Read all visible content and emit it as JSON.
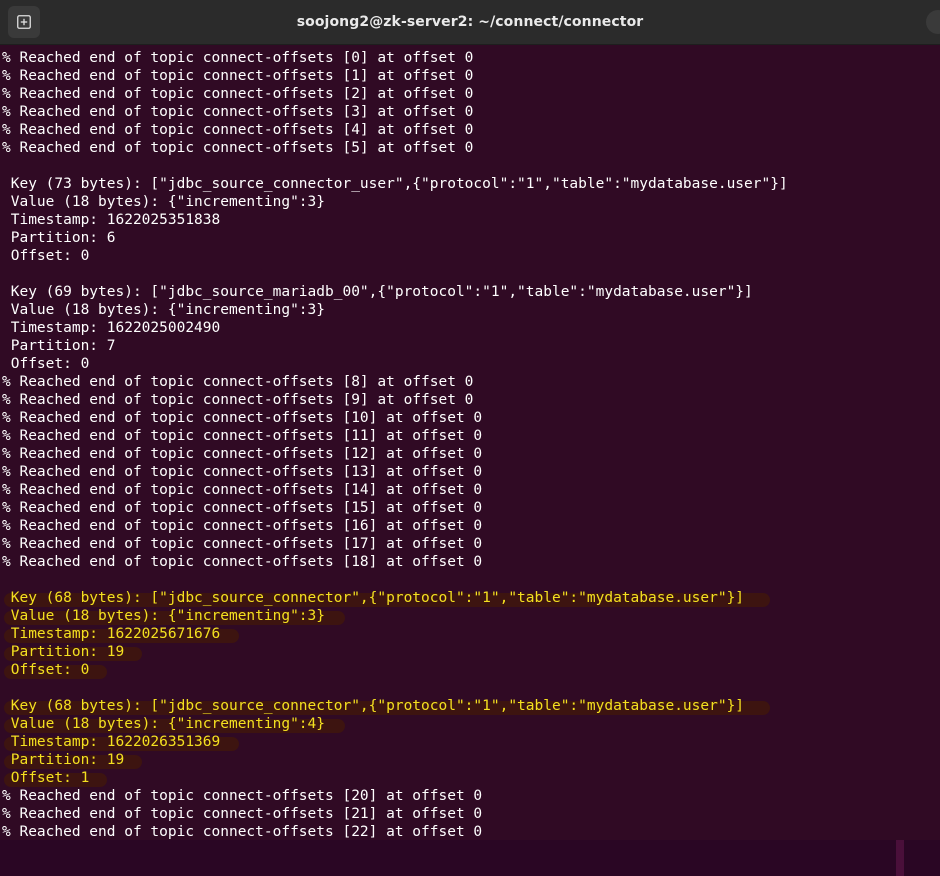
{
  "window": {
    "title": "soojong2@zk-server2: ~/connect/connector"
  },
  "terminal": {
    "lines": [
      {
        "text": "% Reached end of topic connect-offsets [0] at offset 0",
        "highlight": false
      },
      {
        "text": "% Reached end of topic connect-offsets [1] at offset 0",
        "highlight": false
      },
      {
        "text": "% Reached end of topic connect-offsets [2] at offset 0",
        "highlight": false
      },
      {
        "text": "% Reached end of topic connect-offsets [3] at offset 0",
        "highlight": false
      },
      {
        "text": "% Reached end of topic connect-offsets [4] at offset 0",
        "highlight": false
      },
      {
        "text": "% Reached end of topic connect-offsets [5] at offset 0",
        "highlight": false
      },
      {
        "text": "",
        "highlight": false
      },
      {
        "text": " Key (73 bytes): [\"jdbc_source_connector_user\",{\"protocol\":\"1\",\"table\":\"mydatabase.user\"}]",
        "highlight": false
      },
      {
        "text": " Value (18 bytes): {\"incrementing\":3}",
        "highlight": false
      },
      {
        "text": " Timestamp: 1622025351838",
        "highlight": false
      },
      {
        "text": " Partition: 6",
        "highlight": false
      },
      {
        "text": " Offset: 0",
        "highlight": false
      },
      {
        "text": "",
        "highlight": false
      },
      {
        "text": " Key (69 bytes): [\"jdbc_source_mariadb_00\",{\"protocol\":\"1\",\"table\":\"mydatabase.user\"}]",
        "highlight": false
      },
      {
        "text": " Value (18 bytes): {\"incrementing\":3}",
        "highlight": false
      },
      {
        "text": " Timestamp: 1622025002490",
        "highlight": false
      },
      {
        "text": " Partition: 7",
        "highlight": false
      },
      {
        "text": " Offset: 0",
        "highlight": false
      },
      {
        "text": "% Reached end of topic connect-offsets [8] at offset 0",
        "highlight": false
      },
      {
        "text": "% Reached end of topic connect-offsets [9] at offset 0",
        "highlight": false
      },
      {
        "text": "% Reached end of topic connect-offsets [10] at offset 0",
        "highlight": false
      },
      {
        "text": "% Reached end of topic connect-offsets [11] at offset 0",
        "highlight": false
      },
      {
        "text": "% Reached end of topic connect-offsets [12] at offset 0",
        "highlight": false
      },
      {
        "text": "% Reached end of topic connect-offsets [13] at offset 0",
        "highlight": false
      },
      {
        "text": "% Reached end of topic connect-offsets [14] at offset 0",
        "highlight": false
      },
      {
        "text": "% Reached end of topic connect-offsets [15] at offset 0",
        "highlight": false
      },
      {
        "text": "% Reached end of topic connect-offsets [16] at offset 0",
        "highlight": false
      },
      {
        "text": "% Reached end of topic connect-offsets [17] at offset 0",
        "highlight": false
      },
      {
        "text": "% Reached end of topic connect-offsets [18] at offset 0",
        "highlight": false
      },
      {
        "text": "",
        "highlight": false
      },
      {
        "text": " Key (68 bytes): [\"jdbc_source_connector\",{\"protocol\":\"1\",\"table\":\"mydatabase.user\"}]",
        "highlight": true
      },
      {
        "text": " Value (18 bytes): {\"incrementing\":3}",
        "highlight": true
      },
      {
        "text": " Timestamp: 1622025671676",
        "highlight": true
      },
      {
        "text": " Partition: 19",
        "highlight": true
      },
      {
        "text": " Offset: 0",
        "highlight": true
      },
      {
        "text": "",
        "highlight": false
      },
      {
        "text": " Key (68 bytes): [\"jdbc_source_connector\",{\"protocol\":\"1\",\"table\":\"mydatabase.user\"}]",
        "highlight": true
      },
      {
        "text": " Value (18 bytes): {\"incrementing\":4}",
        "highlight": true
      },
      {
        "text": " Timestamp: 1622026351369",
        "highlight": true
      },
      {
        "text": " Partition: 19",
        "highlight": true
      },
      {
        "text": " Offset: 1",
        "highlight": true
      },
      {
        "text": "% Reached end of topic connect-offsets [20] at offset 0",
        "highlight": false
      },
      {
        "text": "% Reached end of topic connect-offsets [21] at offset 0",
        "highlight": false
      },
      {
        "text": "% Reached end of topic connect-offsets [22] at offset 0",
        "highlight": false
      }
    ]
  },
  "colors": {
    "terminal_background": "#300a24",
    "terminal_text": "#ffffff",
    "highlight_text": "#f4e020",
    "titlebar": "#2b2b2b"
  },
  "icons": {
    "new_tab": "new-tab-icon"
  }
}
